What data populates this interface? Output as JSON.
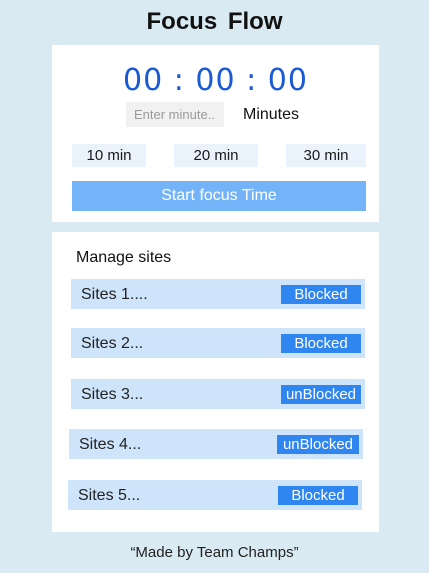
{
  "app": {
    "title": "Focus  Flow"
  },
  "timer": {
    "display": "00 : 00 : 00",
    "input_placeholder": "Enter minute..",
    "minutes_label": "Minutes",
    "presets": [
      "10 min",
      "20 min",
      "30 min"
    ],
    "start_label": "Start focus Time"
  },
  "sites": {
    "title": "Manage sites",
    "items": [
      {
        "name": "Sites 1....",
        "status": "Blocked"
      },
      {
        "name": "Sites 2...",
        "status": "Blocked"
      },
      {
        "name": "Sites 3...",
        "status": "unBlocked"
      },
      {
        "name": "Sites 4...",
        "status": "unBlocked"
      },
      {
        "name": "Sites 5...",
        "status": "Blocked"
      }
    ]
  },
  "footer": {
    "text": "“Made by Team Champs”"
  },
  "colors": {
    "background": "#d9eaf3",
    "timer_text": "#1a5ad6",
    "start_button": "#74b3f7",
    "site_row": "#cde4fb",
    "status_badge": "#2f86f0"
  }
}
